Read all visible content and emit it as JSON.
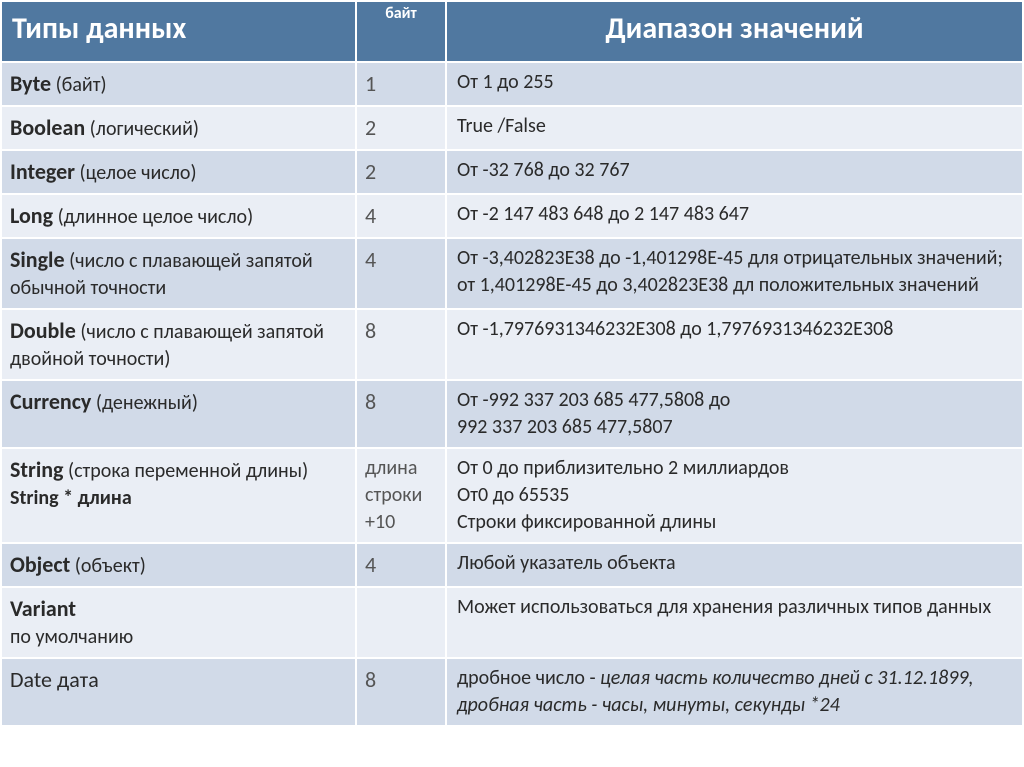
{
  "header": {
    "col_types": "Типы данных",
    "col_bytes": "байт",
    "col_range": "Диапазон значений"
  },
  "rows": [
    {
      "name": "Byte",
      "desc": "(байт)",
      "bytes": "1",
      "range": "От 1 до 255"
    },
    {
      "name": "Boolean",
      "desc": "(логический)",
      "bytes": "2",
      "range": "True /False"
    },
    {
      "name": "Integer",
      "desc": "(целое число)",
      "bytes": "2",
      "range": "От -32 768 до 32 767"
    },
    {
      "name": "Long",
      "desc": "(длинное целое число)",
      "bytes": "4",
      "range": "От -2 147 483 648 до 2 147 483 647"
    },
    {
      "name": "Single",
      "desc": "(число с плавающей запятой обычной точности",
      "bytes": "4",
      "range_lines": [
        "От -3,402823Е38 до -1,401298Е-45 для отрицательных значений;",
        "от 1,401298Е-45 до 3,402823Е38 дл положительных значений"
      ]
    },
    {
      "name": "Double",
      "desc": "(число с плавающей запятой двойной точности)",
      "bytes": "8",
      "range": "От -1,7976931346232Е308 до 1,7976931346232Е308"
    },
    {
      "name": "Currency",
      "desc": "(денежный)",
      "bytes": "8",
      "range_lines": [
        "От -992 337 203 685 477,5808 до",
        "992 337 203 685 477,5807"
      ]
    },
    {
      "name": "String",
      "desc": "(строка переменной длины)",
      "sub": "String * длина",
      "bytes": "длина строки +10",
      "range_lines": [
        "От 0 до приблизительно 2 миллиардов",
        "От0 до 65535",
        "Строки фиксированной длины"
      ]
    },
    {
      "name": "Object",
      "desc": "(объект)",
      "bytes": "4",
      "range": "Любой указатель объекта"
    },
    {
      "name": "Variant",
      "plain_sub": "по умолчанию",
      "bytes": "",
      "range": "Может использоваться для        хранения различных типов данных"
    },
    {
      "name_plain": "Date  дата",
      "bytes": "8",
      "range_prefix": "дробное число - ",
      "range_italic": "целая часть количество дней с 31.12.1899, дробная часть - часы, минуты, секунды *24"
    }
  ]
}
